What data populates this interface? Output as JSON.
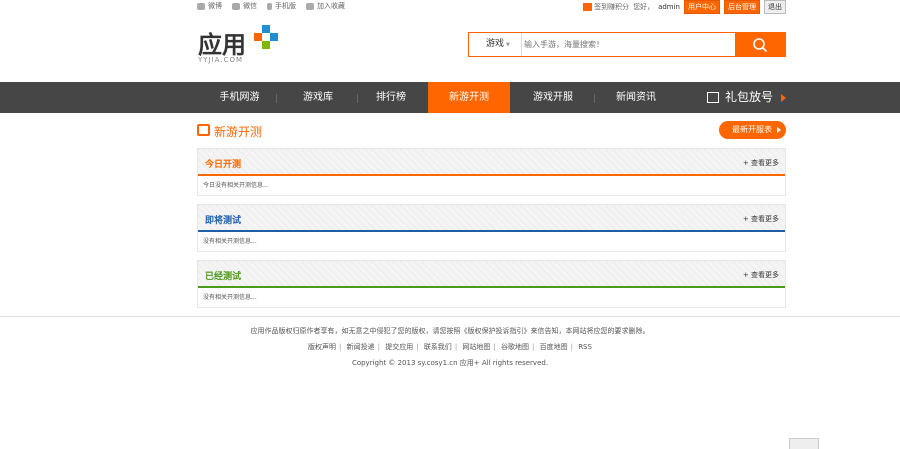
{
  "topbar": {
    "links": [
      {
        "label": "微博",
        "icon": "weibo-icon"
      },
      {
        "label": "微信",
        "icon": "wechat-icon"
      },
      {
        "label": "手机版",
        "icon": "mobile-icon"
      },
      {
        "label": "加入收藏",
        "icon": "folder-icon"
      }
    ],
    "sign_label": "签到赚积分",
    "greeting": "您好，",
    "username": "admin",
    "user_center": "用户中心",
    "admin_panel": "后台管理",
    "logout": "退出"
  },
  "header": {
    "logo_text": "应用",
    "logo_domain": "YYJIA.COM",
    "logo_colors": [
      "#1f8fd6",
      "#ff6600",
      "#1f8fd6",
      "#7fb800"
    ],
    "search_type": "游戏",
    "search_placeholder": "输入手游，海量搜索！"
  },
  "nav": {
    "items": [
      {
        "label": "手机网游"
      },
      {
        "label": "游戏库"
      },
      {
        "label": "排行榜"
      },
      {
        "label": "新游开测",
        "active": true
      },
      {
        "label": "游戏开服"
      },
      {
        "label": "新闻资讯"
      }
    ],
    "gift_label": "礼包放号"
  },
  "main": {
    "page_title": "新游开测",
    "latest_button": "最新开服表",
    "sections": [
      {
        "title": "今日开测",
        "color": "#ff6600",
        "more": "+ 查看更多",
        "empty": "今日没有相关开测信息..."
      },
      {
        "title": "即将测试",
        "color": "#1f5fa8",
        "more": "+ 查看更多",
        "empty": "没有相关开测信息..."
      },
      {
        "title": "已经测试",
        "color": "#4a9a1a",
        "more": "+ 查看更多",
        "empty": "没有相关开测信息..."
      }
    ]
  },
  "footer": {
    "notice": "应用作品版权归原作者享有，如无意之中侵犯了您的版权，请您按照《版权保护投诉指引》来信告知，本网站将应您的要求删除。",
    "links": [
      "版权声明",
      "新闻投递",
      "提交应用",
      "联系我们",
      "网站地图",
      "谷歌地图",
      "百度地图",
      "RSS"
    ],
    "copyright": "Copyright © 2013  sy.cosy1.cn  应用+  All rights reserved."
  },
  "colors": {
    "accent": "#ff6600",
    "nav_bg": "#464646"
  }
}
